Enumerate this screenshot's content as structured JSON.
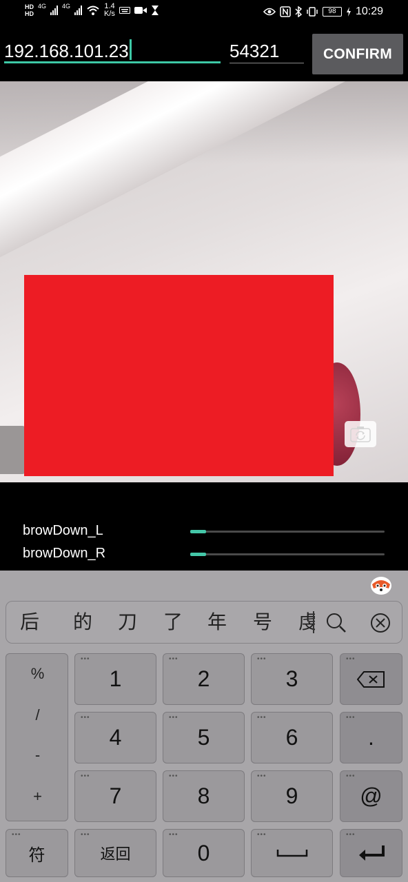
{
  "status_bar": {
    "network_speed_value": "1.4",
    "network_speed_unit": "K/s",
    "battery": "98",
    "time": "10:29",
    "net_type_1": "4G",
    "net_type_2": "4G",
    "hd_1": "HD",
    "hd_2": "HD"
  },
  "connection": {
    "ip_value": "192.168.101.23",
    "port_value": "54321",
    "confirm_label": "CONFIRM"
  },
  "blendshapes": [
    {
      "name": "browDown_L",
      "value": 0.08
    },
    {
      "name": "browDown_R",
      "value": 0.08
    }
  ],
  "keyboard": {
    "candidates": [
      "后",
      "的",
      "刀",
      "了",
      "年",
      "号",
      "虔"
    ],
    "symbols": [
      "%",
      "/",
      "-",
      "+"
    ],
    "keys": {
      "k1": "1",
      "k2": "2",
      "k3": "3",
      "k4": "4",
      "k5": "5",
      "k6": "6",
      "k7": "7",
      "k8": "8",
      "k9": "9",
      "k0": "0",
      "dot": ".",
      "at": "@",
      "fu": "符",
      "back": "返回"
    }
  },
  "colors": {
    "accent": "#3dc9a6",
    "overlay_box": "#ed1c24",
    "confirm_bg": "#5b5b5e"
  }
}
